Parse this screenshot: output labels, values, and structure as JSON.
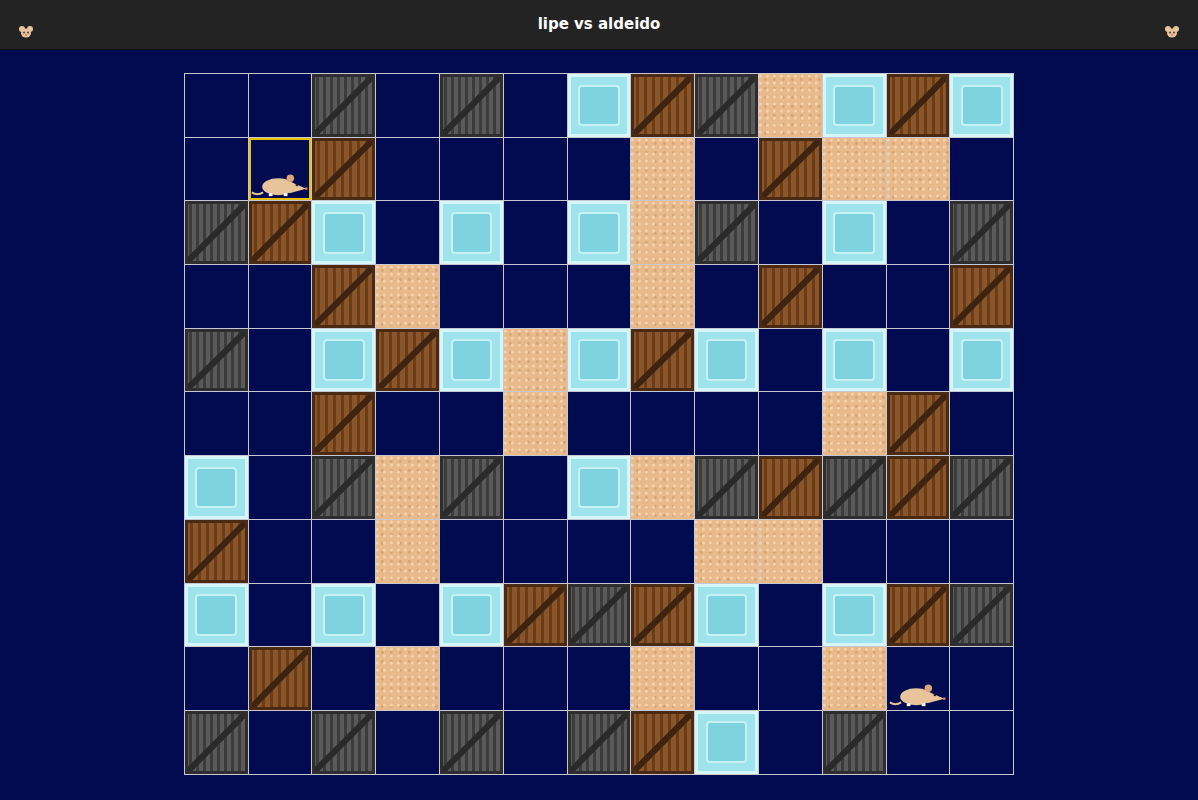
{
  "window": {
    "title": "lipe vs aldeido"
  },
  "board": {
    "cursor": {
      "row": 1,
      "col": 1
    },
    "rows": [
      [
        "empty",
        "empty",
        "steel",
        "empty",
        "steel",
        "empty",
        "ice",
        "wood",
        "steel",
        "sand",
        "ice",
        "wood",
        "ice"
      ],
      [
        "empty",
        "rat",
        "wood",
        "empty",
        "empty",
        "empty",
        "empty",
        "sand",
        "empty",
        "wood",
        "sand",
        "sand",
        "empty"
      ],
      [
        "steel",
        "wood",
        "ice",
        "empty",
        "ice",
        "empty",
        "ice",
        "sand",
        "steel",
        "empty",
        "ice",
        "empty",
        "steel"
      ],
      [
        "empty",
        "empty",
        "wood",
        "sand",
        "empty",
        "empty",
        "empty",
        "sand",
        "empty",
        "wood",
        "empty",
        "empty",
        "wood"
      ],
      [
        "steel",
        "empty",
        "ice",
        "wood",
        "ice",
        "sand",
        "ice",
        "wood",
        "ice",
        "empty",
        "ice",
        "empty",
        "ice"
      ],
      [
        "empty",
        "empty",
        "wood",
        "empty",
        "empty",
        "sand",
        "empty",
        "empty",
        "empty",
        "empty",
        "sand",
        "wood",
        "empty"
      ],
      [
        "ice",
        "empty",
        "steel",
        "sand",
        "steel",
        "empty",
        "ice",
        "sand",
        "steel",
        "wood",
        "steel",
        "wood",
        "steel"
      ],
      [
        "wood",
        "empty",
        "empty",
        "sand",
        "empty",
        "empty",
        "empty",
        "empty",
        "sand",
        "sand",
        "empty",
        "empty",
        "empty"
      ],
      [
        "ice",
        "empty",
        "ice",
        "empty",
        "ice",
        "wood",
        "steel",
        "wood",
        "ice",
        "empty",
        "ice",
        "wood",
        "steel"
      ],
      [
        "empty",
        "wood",
        "empty",
        "sand",
        "empty",
        "empty",
        "empty",
        "sand",
        "empty",
        "empty",
        "sand",
        "rat",
        "empty"
      ],
      [
        "steel",
        "empty",
        "steel",
        "empty",
        "steel",
        "empty",
        "steel",
        "wood",
        "ice",
        "empty",
        "steel",
        "empty",
        "empty"
      ]
    ]
  }
}
